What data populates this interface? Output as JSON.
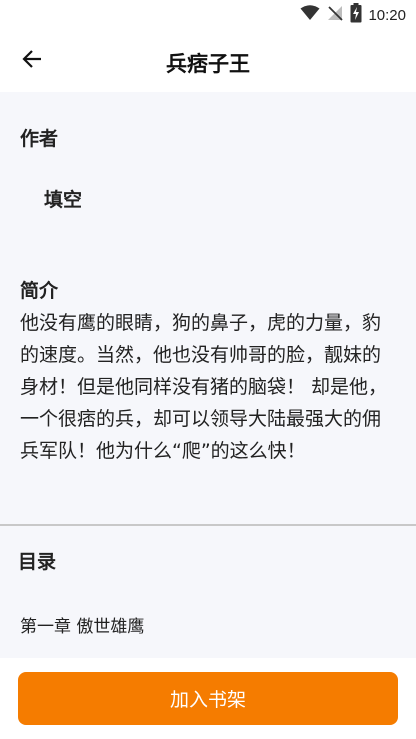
{
  "status_bar": {
    "time": "10:20",
    "icons": [
      "wifi-icon",
      "no-signal-icon",
      "battery-charging-icon"
    ]
  },
  "app_bar": {
    "back_icon": "arrow-back-icon",
    "title": "兵痞子王"
  },
  "author_section": {
    "heading": "作者",
    "name": "填空"
  },
  "intro_section": {
    "heading": "简介",
    "text": "他没有鹰的眼睛，狗的鼻子，虎的力量，豹的速度。当然，他也没有帅哥的脸，靓妹的身材！但是他同样没有猪的脑袋！ 却是他，一个很痞的兵，却可以领导大陆最强大的佣兵军队！他为什么“爬”的这么快！"
  },
  "catalog_section": {
    "heading": "目录",
    "chapters": [
      "第一章 傲世雄鹰"
    ]
  },
  "actions": {
    "add_to_shelf": "加入书架",
    "accent_color": "#f57c00"
  }
}
